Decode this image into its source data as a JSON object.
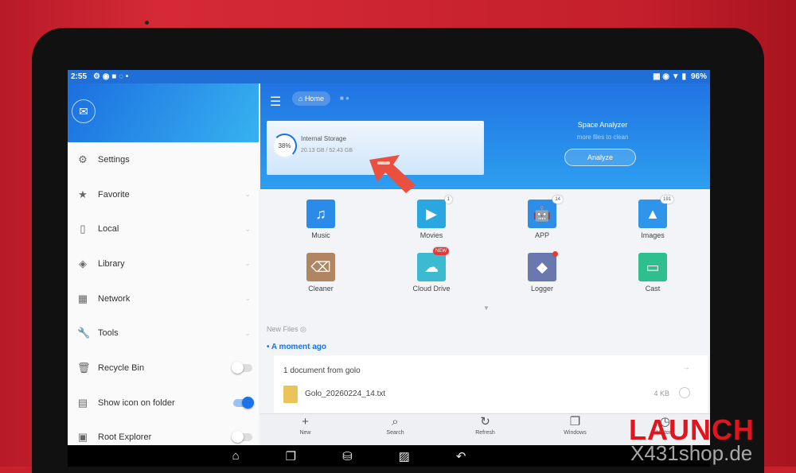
{
  "status": {
    "time": "2:55",
    "battery": "96%"
  },
  "sidebar": {
    "items": [
      {
        "label": "Settings",
        "icon": "⚙"
      },
      {
        "label": "Favorite",
        "icon": "★"
      },
      {
        "label": "Local",
        "icon": "▯"
      },
      {
        "label": "Library",
        "icon": "◈"
      },
      {
        "label": "Network",
        "icon": "▦"
      },
      {
        "label": "Tools",
        "icon": "🔧"
      },
      {
        "label": "Recycle Bin",
        "icon": "🗑"
      },
      {
        "label": "Show icon on folder",
        "icon": "▤"
      },
      {
        "label": "Root Explorer",
        "icon": "▣"
      }
    ]
  },
  "header": {
    "breadcrumb": "Home"
  },
  "storage": {
    "percent": "38%",
    "title": "Internal Storage",
    "size": "20.13 GB / 52.43 GB"
  },
  "analyzer": {
    "title": "Space Analyzer",
    "subtitle": "more files to clean",
    "button": "Analyze"
  },
  "apps": [
    {
      "label": "Music",
      "icon": "♫",
      "color": "#2a8ce8"
    },
    {
      "label": "Movies",
      "icon": "▶",
      "color": "#2aa7e0",
      "badge": "1"
    },
    {
      "label": "APP",
      "icon": "🤖",
      "color": "#2e8de6",
      "badge": "14"
    },
    {
      "label": "Images",
      "icon": "▲",
      "color": "#2f95ea",
      "badge": "191"
    },
    {
      "label": "Cleaner",
      "icon": "⌫",
      "color": "#b08562"
    },
    {
      "label": "Cloud Drive",
      "icon": "☁",
      "color": "#3cbad0",
      "badge": "NEW"
    },
    {
      "label": "Logger",
      "icon": "◆",
      "color": "#6a78b0"
    },
    {
      "label": "Cast",
      "icon": "▭",
      "color": "#2fbf8f"
    }
  ],
  "new_files": {
    "heading": "New Files",
    "group": "A moment ago",
    "card_title": "1 document from golo",
    "file_name": "Golo_20260224_14.txt",
    "file_size": "4 KB"
  },
  "toolbar": [
    {
      "label": "New",
      "icon": "+"
    },
    {
      "label": "Search",
      "icon": "⌕"
    },
    {
      "label": "Refresh",
      "icon": "↻"
    },
    {
      "label": "Windows",
      "icon": "❐"
    },
    {
      "label": "History",
      "icon": "◷"
    }
  ],
  "watermark": {
    "brand": "LAUNCH",
    "site": "X431shop.de"
  }
}
